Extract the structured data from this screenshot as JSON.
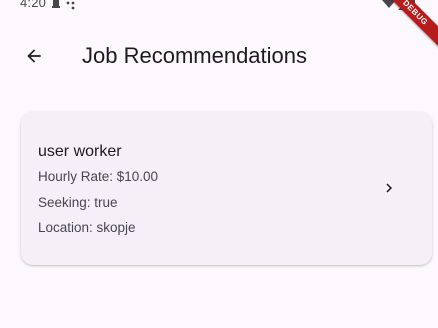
{
  "status_bar": {
    "time": "4:20",
    "debug_banner": "DEBUG"
  },
  "app_bar": {
    "back_icon": "arrow-left-icon",
    "title": "Job Recommendations"
  },
  "recommendations": [
    {
      "name": "user worker",
      "hourly_rate": "Hourly Rate: $10.00",
      "seeking": "Seeking: true",
      "location": "Location: skopje",
      "trailing_icon": "chevron-right-icon"
    }
  ],
  "colors": {
    "background": "#fdf7fe",
    "card": "#f6eff8",
    "text_primary": "#1d1b20",
    "text_secondary": "#49454f",
    "debug_banner": "#b71c1c"
  }
}
